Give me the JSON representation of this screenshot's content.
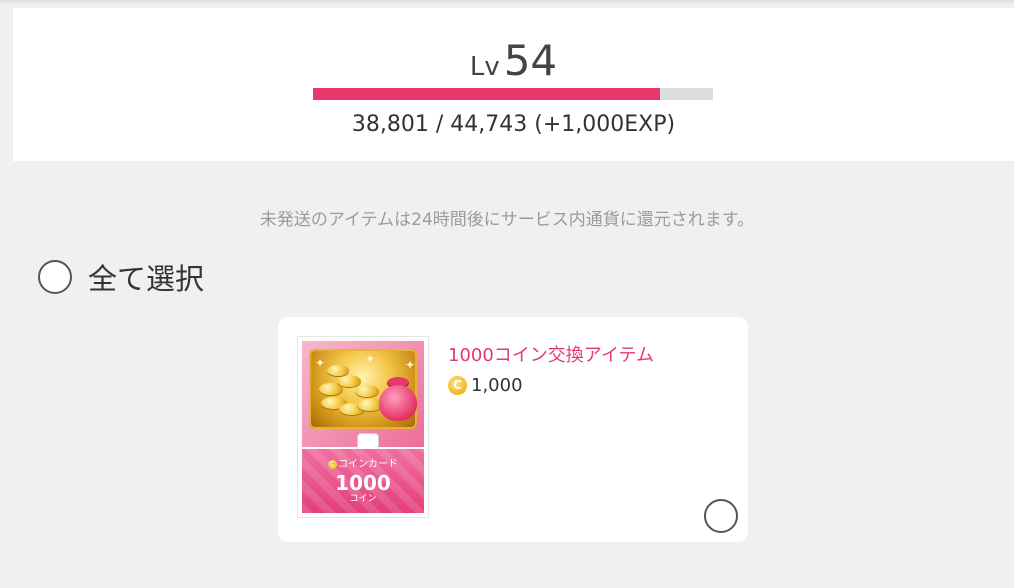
{
  "level": {
    "prefix": "Lv",
    "value": "54",
    "exp_text": "38,801 / 44,743 (+1,000EXP)",
    "progress_fraction": 0.867,
    "bar_color": "#e8386b",
    "track_color": "#dddddd"
  },
  "notice": "未発送のアイテムは24時間後にサービス内通貨に還元されます。",
  "select_all": {
    "label": "全て選択"
  },
  "items": [
    {
      "name": "1000コイン交換アイテム",
      "price": "1,000",
      "price_icon": "coin-icon",
      "thumbnail": {
        "card_type": "コインカード",
        "amount": "1000",
        "unit": "コイン"
      }
    }
  ],
  "colors": {
    "accent": "#e8386b",
    "background": "#f0f0f0"
  }
}
